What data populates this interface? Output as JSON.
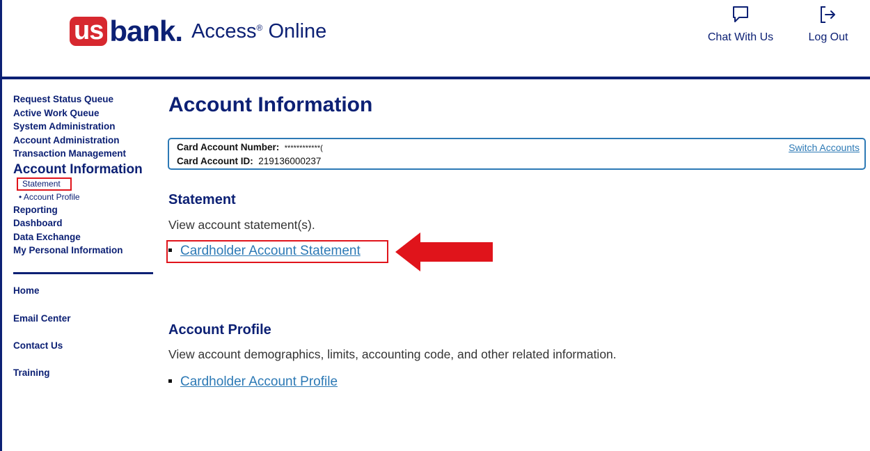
{
  "header": {
    "logo_us": "us",
    "logo_bank": "bank",
    "logo_dot": ".",
    "product": "Access",
    "product_reg": "®",
    "product_suffix": " Online",
    "chat_label": "Chat With Us",
    "logout_label": "Log Out"
  },
  "sidebar": {
    "links": [
      "Request Status Queue",
      "Active Work Queue",
      "System Administration",
      "Account Administration",
      "Transaction Management"
    ],
    "current": "Account Information",
    "sub_items": [
      "Statement",
      "• Account Profile"
    ],
    "links_after": [
      "Reporting",
      "Dashboard",
      "Data Exchange",
      "My Personal Information"
    ],
    "utility": [
      "Home",
      "Email Center",
      "Contact Us",
      "Training"
    ]
  },
  "main": {
    "title": "Account Information",
    "card_number_label": "Card Account Number:",
    "card_number_value": "************(",
    "card_id_label": "Card Account ID:",
    "card_id_value": "219136000237",
    "switch_accounts": "Switch Accounts",
    "statement": {
      "title": "Statement",
      "description": "View account statement(s).",
      "link": "Cardholder Account Statement"
    },
    "profile": {
      "title": "Account Profile",
      "description": "View account demographics, limits, accounting code, and other related information.",
      "link": "Cardholder Account Profile"
    }
  },
  "colors": {
    "brand_navy": "#0c2074",
    "brand_red": "#d7282f",
    "link_blue": "#2c79b5",
    "highlight_red": "#e0141b"
  }
}
